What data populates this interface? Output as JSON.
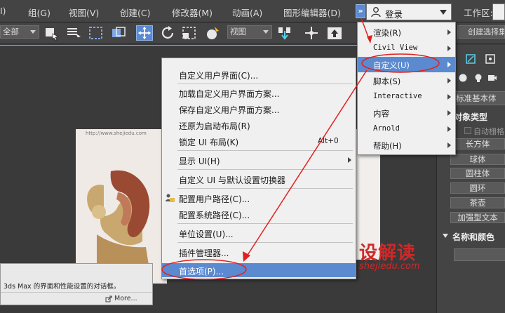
{
  "menubar": {
    "items": [
      "I)",
      "组(G)",
      "视图(V)",
      "创建(C)",
      "修改器(M)",
      "动画(A)",
      "图形编辑器(D)"
    ],
    "more": "»",
    "login": "登录",
    "workspace_label": "工作区:"
  },
  "toolbar": {
    "filter": "全部",
    "view": "视图",
    "create_selection_set": "创建选择集"
  },
  "viewport": {
    "watermark_url": "http://www.shejiedu.com",
    "brand_cn": "设解读",
    "brand_en": "shejiedu.com"
  },
  "tooltip": {
    "text": "3ds Max 的界面和性能设置的对话框。",
    "more": "More..."
  },
  "main_menu": {
    "items": [
      {
        "label": "渲染(R)"
      },
      {
        "label": "Civil View"
      },
      {
        "label": "自定义(U)"
      },
      {
        "label": "脚本(S)"
      },
      {
        "label": "Interactive"
      },
      {
        "label": "内容"
      },
      {
        "label": "Arnold"
      },
      {
        "label": "帮助(H)"
      }
    ]
  },
  "custom_menu": {
    "items": [
      {
        "label": "自定义用户界面(C)..."
      },
      {
        "label": "加载自定义用户界面方案..."
      },
      {
        "label": "保存自定义用户界面方案..."
      },
      {
        "label": "还原为启动布局(R)"
      },
      {
        "label": "锁定 UI 布局(K)",
        "shortcut": "Alt+0"
      },
      {
        "label": "显示 UI(H)"
      },
      {
        "label": "自定义 UI 与默认设置切换器"
      },
      {
        "label": "配置用户路径(C)..."
      },
      {
        "label": "配置系统路径(C)..."
      },
      {
        "label": "单位设置(U)..."
      },
      {
        "label": "插件管理器..."
      },
      {
        "label": "首选项(P)..."
      }
    ]
  },
  "command_panel": {
    "category": "标准基本体",
    "object_type": "对象类型",
    "autogrid": "自动栅格",
    "buttons": [
      "长方体",
      "球体",
      "圆柱体",
      "圆环",
      "茶壶",
      "加强型文本"
    ],
    "name_color": "名称和颜色"
  },
  "colors": {
    "highlight": "#5b8ad0",
    "annotation_red": "#e02020"
  }
}
